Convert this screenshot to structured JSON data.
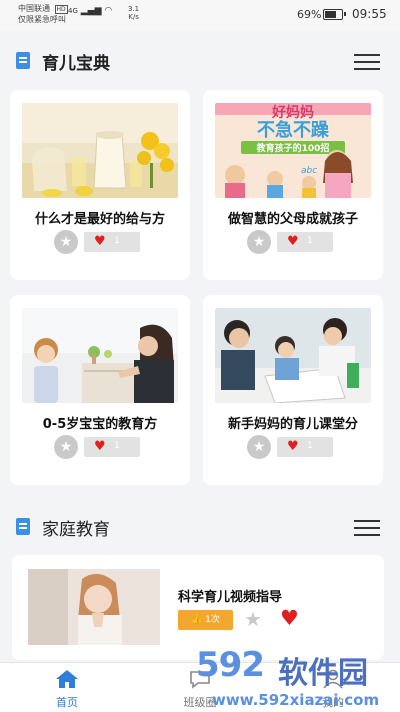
{
  "status_bar": {
    "carrier": "中国联通",
    "carrier_badge": "HD",
    "emergency": "仅限紧急呼叫",
    "network": "4G",
    "net_speed": "3.1",
    "net_unit": "K/s",
    "battery_percent": "69%",
    "battery_level": 0.69,
    "time": "09:55"
  },
  "sections": [
    {
      "title": "育儿宝典",
      "cards": [
        {
          "title": "什么才是最好的给与方",
          "likes": "1"
        },
        {
          "title": "做智慧的父母成就孩子",
          "likes": "1"
        },
        {
          "title": "0-5岁宝宝的教育方",
          "likes": "1"
        },
        {
          "title": "新手妈妈的育儿课堂分",
          "likes": "1"
        }
      ]
    },
    {
      "title": "家庭教育",
      "videos": [
        {
          "title": "科学育儿视频指导",
          "views": "1次"
        }
      ]
    }
  ],
  "book_cover": {
    "line1": "好妈妈",
    "line2": "不急不躁",
    "line3": "教育孩子的100招",
    "letters": "abc"
  },
  "tabbar": {
    "items": [
      {
        "label": "首页",
        "active": true
      },
      {
        "label": "班级圈",
        "active": false
      },
      {
        "label": "我的",
        "active": false
      }
    ]
  },
  "watermark": {
    "number": "592",
    "text": "软件园",
    "url": "www.592xiazai.com"
  },
  "colors": {
    "accent": "#3b8fe5",
    "like": "#e02020",
    "badge": "#f3a72f"
  },
  "icons": [
    "document-icon",
    "menu-icon",
    "star-icon",
    "heart-icon",
    "thumbs-up-icon",
    "home-icon",
    "chat-icon",
    "user-icon"
  ]
}
